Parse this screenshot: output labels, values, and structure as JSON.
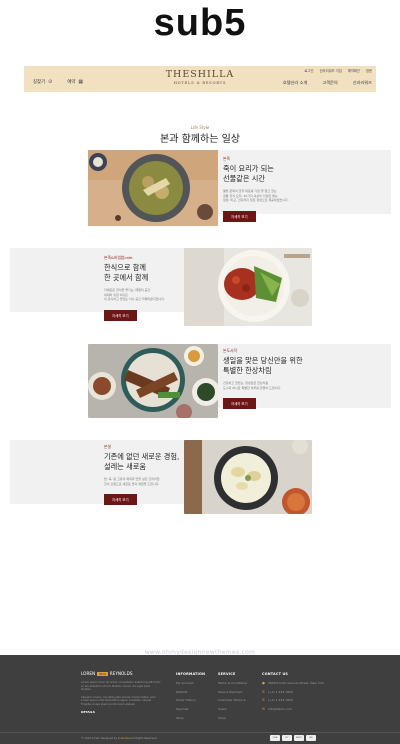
{
  "page_title": "sub5",
  "header": {
    "left_items": [
      {
        "label": "길찾기",
        "icon": "location-icon"
      },
      {
        "label": "예약",
        "icon": "calendar-icon"
      }
    ],
    "logo_line1": "THESHILLA",
    "logo_line2": "HOTELS & RESORTS",
    "top_links": [
      "로그인",
      "신라리워즈 가입",
      "예약확인",
      "영문"
    ],
    "nav_items": [
      "호텔신라 소개",
      "고객문의",
      "신라리워즈"
    ]
  },
  "section": {
    "subtitle": "Life Style",
    "title": "본과 함께하는 일상"
  },
  "features": [
    {
      "tag": "본죽",
      "heading_line1": "죽이 요리가 되는",
      "heading_line2": "선물같은 시간",
      "desc_line1": "웰빙 문화의 한국 대표를 가장 잘 알고 있는",
      "desc_line2": "정통 한식 요리. 30가지 이상의 다양한 메뉴",
      "desc_line3": "정성, 비교, 건강까지 담은 정성으로 제공하겠습니다.",
      "button_label": "자세히 보기"
    },
    {
      "tag": "본죽&비빔밥cafe",
      "heading_line1": "한식으로 함께",
      "heading_line2": "한 곳에서 함께",
      "desc_line1": "다채로운 한식을 즐기는, 패밀리 공간",
      "desc_line2": "세대와 취향 어디든",
      "desc_line3": "이 휴식하고 맛있는 식사 공간 카페라운지입니다.",
      "button_label": "자세히 보기"
    },
    {
      "tag": "본도시락",
      "heading_line1": "생일을 맞은 당신만을 위한",
      "heading_line2": "특별한 한상차림",
      "desc_line1": "건강하고 맛있는, 정성담은 한상차림",
      "desc_line2": "도시락 하나로 특별한 하루를 만들어 드립니다.",
      "desc_line3": "",
      "button_label": "자세히 보기"
    },
    {
      "tag": "본설",
      "heading_line1": "기존에 없던 새로운 경험,",
      "heading_line2": "설레는 새로움",
      "desc_line1": "밥, 죽, 탕 고유의 매력과 맛을 살린 프리미엄",
      "desc_line2": "한식 브랜드로 새로운 맛의 경험을 드립니다.",
      "desc_line3": "",
      "button_label": "자세히 보기"
    }
  ],
  "watermark": "www.ohmydesignnewthemes.com",
  "footer": {
    "logo_left": "LOREN",
    "logo_box": "ipsu",
    "logo_right": "REYNOLDS",
    "about_p1": "Lorem ipsum dolor sit amet, consectetur adipiscing elit tortor ac leo pharetra rutrum. Nullam rutrum nisi eget justo facilisis.",
    "about_p2": "Aliquam ornare, convallis justo iaculis, mauris tellus, sem Lorem ipsum nibh fermentum ligula. Curabitur aliquet fringilla ornare ipsum porta lorem aliquet.",
    "details_label": "DETAILS",
    "info_title": "INFORMATION",
    "info_items": [
      "My Account",
      "Wishlist",
      "Order History",
      "Specials",
      "Shop"
    ],
    "service_title": "SERVICE",
    "service_items": [
      "Terms & Conditions",
      "Secure Payment",
      "Customer Terms &",
      "Users",
      "Shop"
    ],
    "contact_title": "CONTACT US",
    "contact_items": [
      {
        "icon": "pin-icon",
        "text": "3648 Fourth Avenue Street, New York"
      },
      {
        "icon": "phone-icon",
        "text": "(+1) 1 234 7890"
      },
      {
        "icon": "phone-icon",
        "text": "(+1) 1 234 7890"
      },
      {
        "icon": "mail-icon",
        "text": "info@demo.com"
      }
    ],
    "copyright_prefix": "© 2018 Lorem Designed by ",
    "copyright_link": "LorenIpsu",
    "copyright_suffix": " All Rights Reserved.",
    "payments": [
      "VISA",
      "MC",
      "AMEX",
      "PAY"
    ]
  }
}
